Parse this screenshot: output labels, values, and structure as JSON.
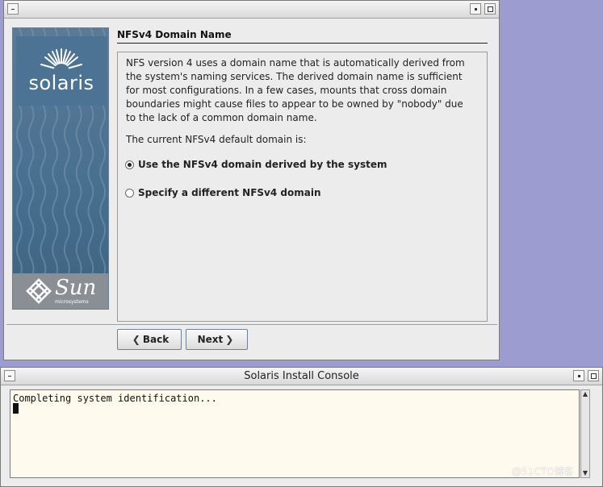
{
  "installer": {
    "title": "",
    "heading": "NFSv4 Domain Name",
    "description": "NFS version 4 uses a domain name that is automatically derived from the system's naming services. The derived domain name is sufficient for most configurations. In a few cases, mounts that cross domain boundaries might cause files to appear to be owned by \"nobody\" due to the lack of a common domain name.",
    "current_label": "The current NFSv4 default domain is:",
    "options": [
      {
        "label": "Use the NFSv4 domain derived by the system",
        "selected": true
      },
      {
        "label": "Specify a different NFSv4 domain",
        "selected": false
      }
    ],
    "back_label": "Back",
    "next_label": "Next",
    "brand_logo": "solaris",
    "vendor_logo": "Sun",
    "vendor_sub": "microsystems"
  },
  "console": {
    "title": "Solaris Install Console",
    "text": "Completing system identification..."
  },
  "watermark": "@51CTO博客",
  "colors": {
    "desktop": "#9c9cd0",
    "window": "#ececec",
    "console_bg": "#fffaee"
  }
}
